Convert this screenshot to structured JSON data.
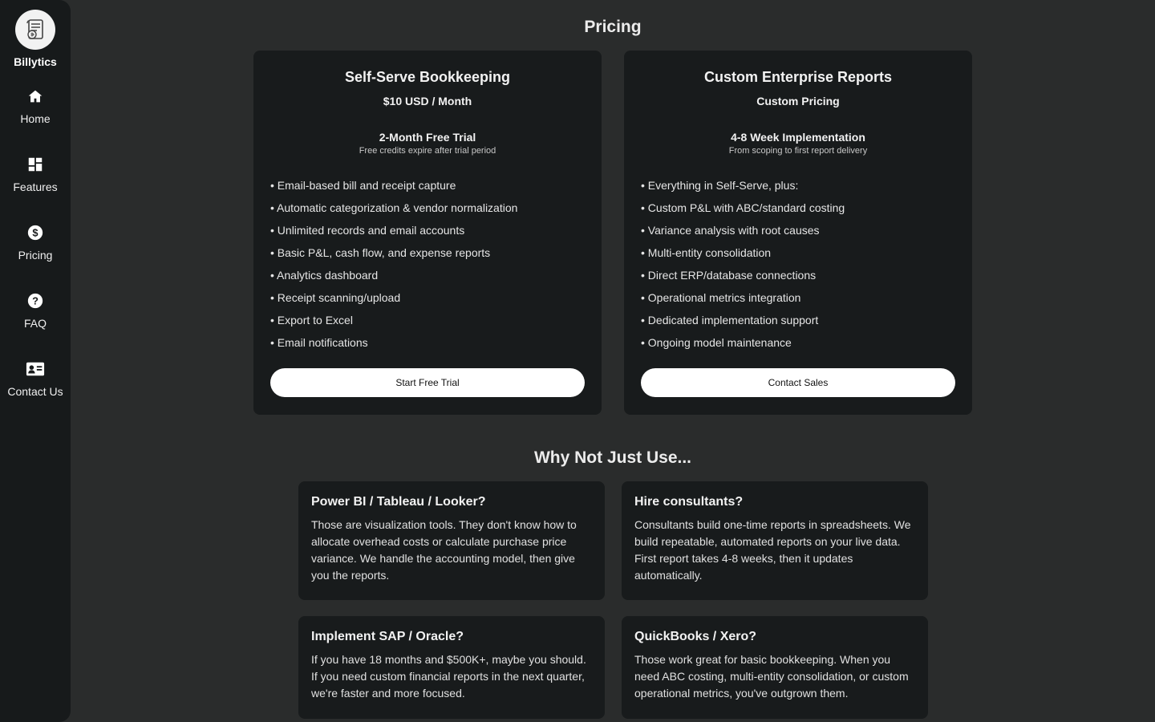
{
  "sidebar": {
    "brand": "Billytics",
    "items": [
      {
        "label": "Home",
        "icon": "home-icon"
      },
      {
        "label": "Features",
        "icon": "dashboard-icon"
      },
      {
        "label": "Pricing",
        "icon": "dollar-icon"
      },
      {
        "label": "FAQ",
        "icon": "help-icon"
      },
      {
        "label": "Contact Us",
        "icon": "contact-card-icon"
      }
    ]
  },
  "main": {
    "title": "Pricing",
    "plans": [
      {
        "name": "Self-Serve Bookkeeping",
        "price": "$10 USD / Month",
        "trial": "2-Month Free Trial",
        "trial_note": "Free credits expire after trial period",
        "features": [
          "Email-based bill and receipt capture",
          "Automatic categorization & vendor normalization",
          "Unlimited records and email accounts",
          "Basic P&L, cash flow, and expense reports",
          "Analytics dashboard",
          "Receipt scanning/upload",
          "Export to Excel",
          "Email notifications"
        ],
        "cta": "Start Free Trial"
      },
      {
        "name": "Custom Enterprise Reports",
        "price": "Custom Pricing",
        "trial": "4-8 Week Implementation",
        "trial_note": "From scoping to first report delivery",
        "features": [
          "Everything in Self-Serve, plus:",
          "Custom P&L with ABC/standard costing",
          "Variance analysis with root causes",
          "Multi-entity consolidation",
          "Direct ERP/database connections",
          "Operational metrics integration",
          "Dedicated implementation support",
          "Ongoing model maintenance"
        ],
        "cta": "Contact Sales"
      }
    ],
    "comparison_title": "Why Not Just Use...",
    "comparisons": [
      {
        "title": "Power BI / Tableau / Looker?",
        "text": "Those are visualization tools. They don't know how to allocate overhead costs or calculate purchase price variance. We handle the accounting model, then give you the reports."
      },
      {
        "title": "Hire consultants?",
        "text": "Consultants build one-time reports in spreadsheets. We build repeatable, automated reports on your live data. First report takes 4-8 weeks, then it updates automatically."
      },
      {
        "title": "Implement SAP / Oracle?",
        "text": "If you have 18 months and $500K+, maybe you should. If you need custom financial reports in the next quarter, we're faster and more focused."
      },
      {
        "title": "QuickBooks / Xero?",
        "text": "Those work great for basic bookkeeping. When you need ABC costing, multi-entity consolidation, or custom operational metrics, you've outgrown them."
      }
    ]
  }
}
